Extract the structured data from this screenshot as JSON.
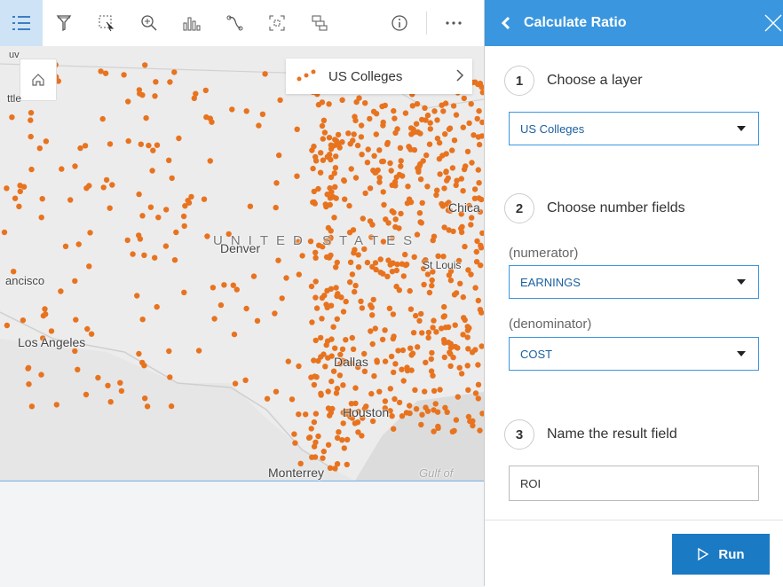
{
  "toolbar": {
    "buttons": [
      {
        "icon": "list-icon",
        "active": true
      },
      {
        "icon": "filter-icon"
      },
      {
        "icon": "select-icon"
      },
      {
        "icon": "zoom-icon"
      },
      {
        "icon": "chart-icon"
      },
      {
        "icon": "link-icon"
      },
      {
        "icon": "extent-icon"
      },
      {
        "icon": "layers-icon"
      },
      {
        "icon": "info-icon"
      },
      {
        "icon": "more-icon"
      }
    ]
  },
  "map": {
    "layer_card": {
      "title": "US Colleges"
    },
    "point_color": "#e8731f",
    "labels": {
      "top_left": "uv",
      "seattle": "ttle",
      "country": "UNITED STATES",
      "denver": "Denver",
      "chicago": "Chica",
      "st_louis": "St Louis",
      "san_francisco": "ancisco",
      "los_angeles": "Los Angeles",
      "dallas": "Dallas",
      "houston": "Houston",
      "monterrey": "Monterrey",
      "gulf": "Gulf of"
    }
  },
  "panel": {
    "title": "Calculate Ratio",
    "header_color": "#3a97df",
    "steps": [
      {
        "number": "1",
        "label": "Choose a layer"
      },
      {
        "number": "2",
        "label": "Choose number fields"
      },
      {
        "number": "3",
        "label": "Name the result field"
      }
    ],
    "layer_select": "US Colleges",
    "numerator_label": "(numerator)",
    "numerator_value": "EARNINGS",
    "denominator_label": "(denominator)",
    "denominator_value": "COST",
    "result_field": "ROI",
    "run_label": "Run",
    "run_color": "#1a7ac4"
  }
}
